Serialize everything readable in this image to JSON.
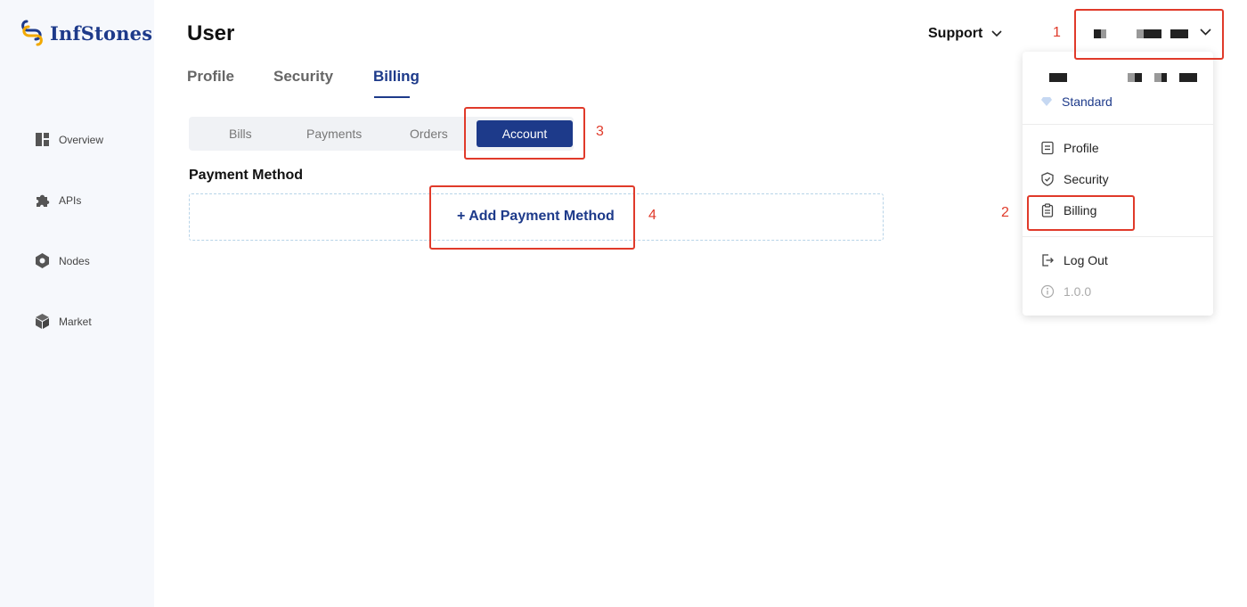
{
  "brand": {
    "name": "InfStones"
  },
  "sidebar": {
    "items": [
      {
        "label": "Overview",
        "icon": "dashboard-icon"
      },
      {
        "label": "APIs",
        "icon": "puzzle-icon"
      },
      {
        "label": "Nodes",
        "icon": "hexagon-node-icon"
      },
      {
        "label": "Market",
        "icon": "cube-icon"
      }
    ]
  },
  "header": {
    "title": "User",
    "support_label": "Support"
  },
  "tabs": [
    {
      "label": "Profile"
    },
    {
      "label": "Security"
    },
    {
      "label": "Billing",
      "active": true
    }
  ],
  "billing_tabs": [
    {
      "label": "Bills"
    },
    {
      "label": "Payments"
    },
    {
      "label": "Orders"
    },
    {
      "label": "Account",
      "active": true
    }
  ],
  "payment": {
    "section_title": "Payment Method",
    "add_label": "+ Add Payment Method"
  },
  "user_menu": {
    "tier": "Standard",
    "items": [
      {
        "label": "Profile",
        "icon": "profile-doc-icon"
      },
      {
        "label": "Security",
        "icon": "shield-check-icon"
      },
      {
        "label": "Billing",
        "icon": "clipboard-icon"
      },
      {
        "label": "Log Out",
        "icon": "logout-icon"
      }
    ],
    "version": "1.0.0"
  },
  "annotations": [
    "1",
    "2",
    "3",
    "4"
  ],
  "colors": {
    "brand": "#1d3a8a",
    "annotation": "#e03a2a",
    "sidebar_bg": "#f6f8fc"
  }
}
